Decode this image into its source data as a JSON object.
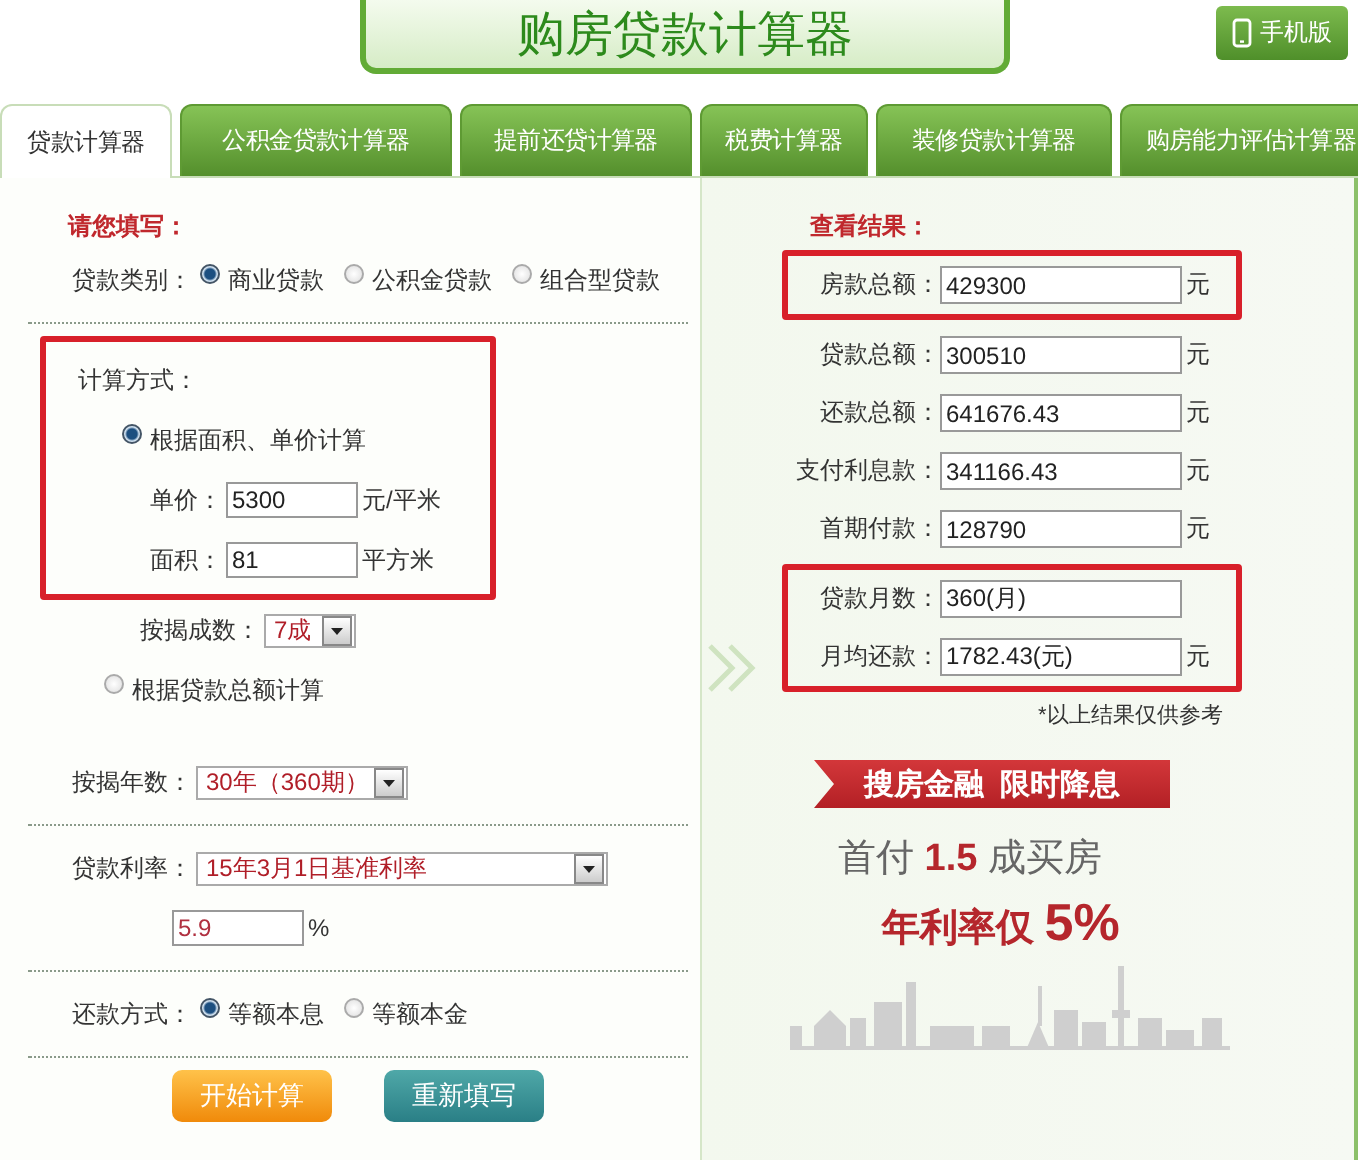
{
  "header": {
    "title": "购房贷款计算器",
    "mobile_button": "手机版"
  },
  "tabs": [
    {
      "label": "贷款计算器",
      "selected": true
    },
    {
      "label": "公积金贷款计算器",
      "selected": false
    },
    {
      "label": "提前还贷计算器",
      "selected": false
    },
    {
      "label": "税费计算器",
      "selected": false
    },
    {
      "label": "装修贷款计算器",
      "selected": false
    },
    {
      "label": "购房能力评估计算器",
      "selected": false
    }
  ],
  "form": {
    "heading": "请您填写：",
    "loan_type": {
      "label": "贷款类别：",
      "options": [
        {
          "label": "商业贷款",
          "selected": true
        },
        {
          "label": "公积金贷款",
          "selected": false
        },
        {
          "label": "组合型贷款",
          "selected": false
        }
      ]
    },
    "method": {
      "label": "计算方式：",
      "highlighted": true,
      "options": [
        {
          "label": "根据面积、单价计算",
          "selected": true,
          "fields": [
            {
              "label": "单价：",
              "value": "5300",
              "unit": "元/平米"
            },
            {
              "label": "面积：",
              "value": "81",
              "unit": "平方米"
            }
          ]
        },
        {
          "label": "根据贷款总额计算",
          "selected": false
        }
      ]
    },
    "down_payment_ratio": {
      "label": "按揭成数：",
      "value": "7成"
    },
    "term": {
      "label": "按揭年数：",
      "value": "30年（360期）"
    },
    "rate": {
      "label": "贷款利率：",
      "value": "15年3月1日基准利率",
      "percent": "5.9",
      "unit": "%"
    },
    "repayment": {
      "label": "还款方式：",
      "options": [
        {
          "label": "等额本息",
          "selected": true
        },
        {
          "label": "等额本金",
          "selected": false
        }
      ]
    },
    "buttons": [
      {
        "label": "开始计算",
        "kind": "primary"
      },
      {
        "label": "重新填写",
        "kind": "secondary"
      }
    ]
  },
  "results": {
    "heading": "查看结果：",
    "groups": [
      {
        "highlighted": true,
        "rows": [
          {
            "label": "房款总额：",
            "value": "429300",
            "unit": "元"
          }
        ]
      },
      {
        "highlighted": false,
        "rows": [
          {
            "label": "贷款总额：",
            "value": "300510",
            "unit": "元"
          },
          {
            "label": "还款总额：",
            "value": "641676.43",
            "unit": "元"
          },
          {
            "label": "支付利息款：",
            "value": "341166.43",
            "unit": "元"
          },
          {
            "label": "首期付款：",
            "value": "128790",
            "unit": "元"
          }
        ]
      },
      {
        "highlighted": true,
        "rows": [
          {
            "label": "贷款月数：",
            "value": "360(月)"
          },
          {
            "label": "月均还款：",
            "value": "1782.43(元)",
            "unit": "元"
          }
        ]
      }
    ],
    "note": "*以上结果仅供参考"
  },
  "promo": {
    "ribbon": "搜房金融  限时降息",
    "line1": "首付 **1.5** 成买房",
    "line2": "年利率仅 **5%**"
  }
}
